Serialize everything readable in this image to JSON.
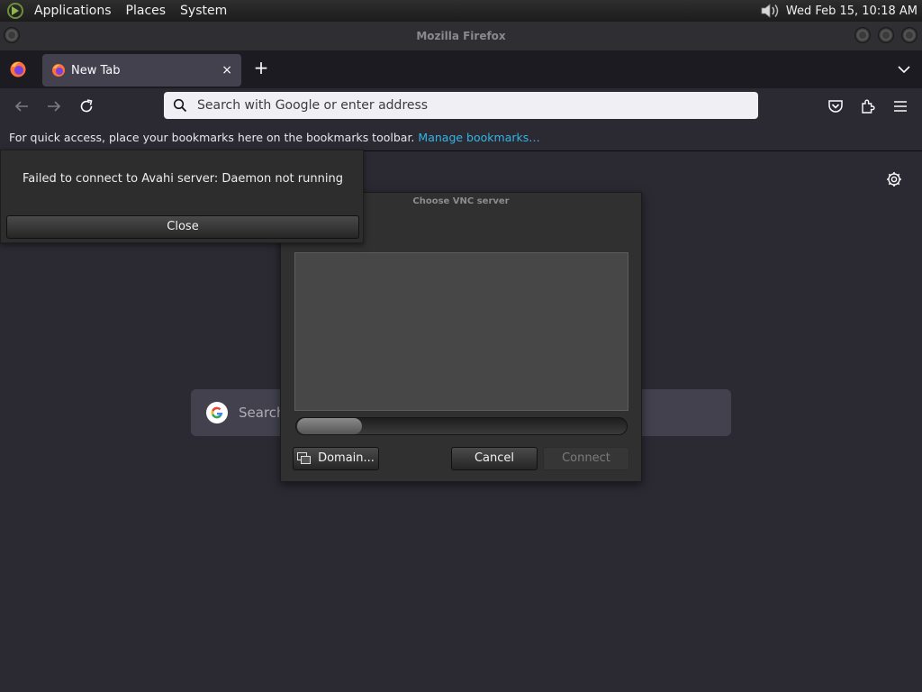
{
  "panel": {
    "menus": [
      "Applications",
      "Places",
      "System"
    ],
    "clock": "Wed Feb 15, 10:18 AM",
    "icons": {
      "logo": "desktop-logo-icon",
      "volume": "volume-icon"
    }
  },
  "window": {
    "title": "Mozilla Firefox"
  },
  "tabs": [
    {
      "label": "New Tab",
      "close_glyph": "×"
    }
  ],
  "tabbar": {
    "new_tab_glyph": "+"
  },
  "urlbar": {
    "placeholder": "Search with Google or enter address",
    "value": ""
  },
  "bookmarks_toolbar": {
    "message": "For quick access, place your bookmarks here on the bookmarks toolbar.",
    "manage_link": "Manage bookmarks…"
  },
  "newtab_page": {
    "search_placeholder": "Search"
  },
  "avahi_dialog": {
    "message": "Failed to connect to Avahi server: Daemon not running",
    "close_label": "Close"
  },
  "vnc_dialog": {
    "title": "Choose VNC server",
    "server_list": [],
    "progress_activity": "pulsing",
    "domain_label": "Domain...",
    "cancel_label": "Cancel",
    "connect_label": "Connect",
    "connect_enabled": false
  },
  "colors": {
    "accent_link": "#33b5e5",
    "content_bg": "#2b2a33",
    "tab_active_bg": "#42414d",
    "urlbar_bg": "#f0f0f4"
  }
}
